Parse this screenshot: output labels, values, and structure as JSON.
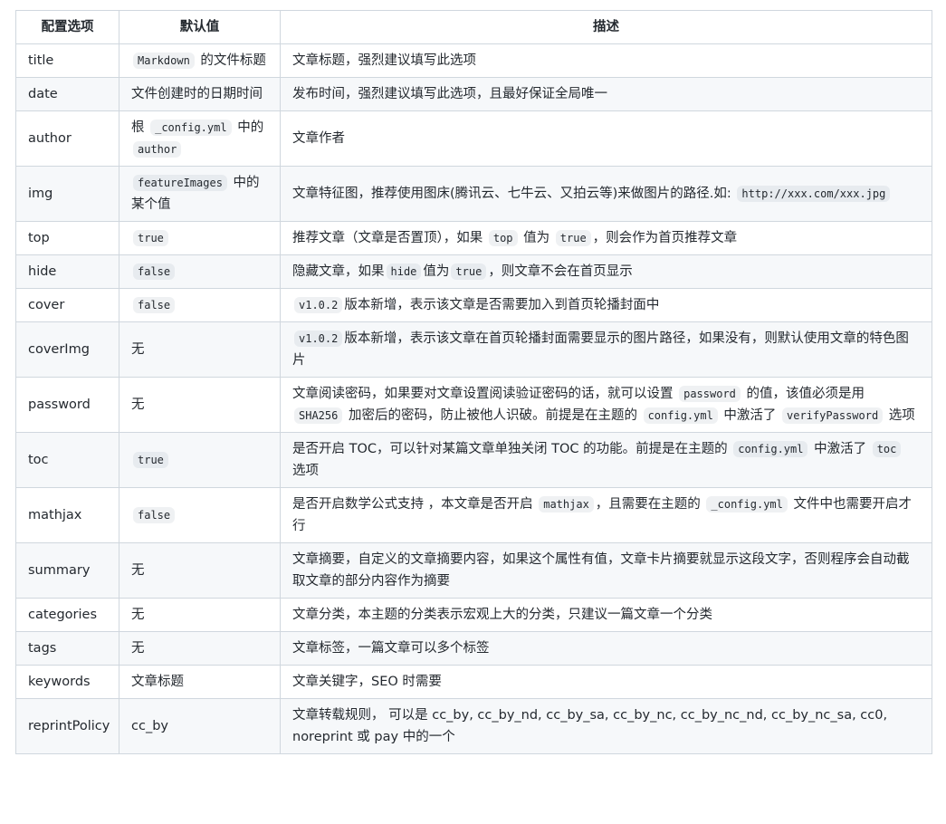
{
  "headers": [
    "配置选项",
    "默认值",
    "描述"
  ],
  "rows": [
    {
      "option": "title",
      "default": [
        {
          "code": "Markdown"
        },
        {
          "text": " 的文件标题"
        }
      ],
      "desc": [
        {
          "text": "文章标题，强烈建议填写此选项"
        }
      ]
    },
    {
      "option": "date",
      "default": [
        {
          "text": "文件创建时的日期时间"
        }
      ],
      "desc": [
        {
          "text": "发布时间，强烈建议填写此选项，且最好保证全局唯一"
        }
      ]
    },
    {
      "option": "author",
      "default": [
        {
          "text": "根 "
        },
        {
          "code": "_config.yml"
        },
        {
          "text": " 中的 "
        },
        {
          "code": "author"
        }
      ],
      "desc": [
        {
          "text": "文章作者"
        }
      ]
    },
    {
      "option": "img",
      "default": [
        {
          "code": "featureImages"
        },
        {
          "text": " 中的某个值"
        }
      ],
      "desc": [
        {
          "text": "文章特征图，推荐使用图床(腾讯云、七牛云、又拍云等)来做图片的路径.如: "
        },
        {
          "code": "http://xxx.com/xxx.jpg"
        }
      ]
    },
    {
      "option": "top",
      "default": [
        {
          "code": "true"
        }
      ],
      "desc": [
        {
          "text": "推荐文章（文章是否置顶），如果 "
        },
        {
          "code": "top"
        },
        {
          "text": " 值为 "
        },
        {
          "code": "true"
        },
        {
          "text": "，则会作为首页推荐文章"
        }
      ]
    },
    {
      "option": "hide",
      "default": [
        {
          "code": "false"
        }
      ],
      "desc": [
        {
          "text": "隐藏文章，如果"
        },
        {
          "code": "hide"
        },
        {
          "text": "值为"
        },
        {
          "code": "true"
        },
        {
          "text": "，则文章不会在首页显示"
        }
      ]
    },
    {
      "option": "cover",
      "default": [
        {
          "code": "false"
        }
      ],
      "desc": [
        {
          "code": "v1.0.2"
        },
        {
          "text": "版本新增，表示该文章是否需要加入到首页轮播封面中"
        }
      ]
    },
    {
      "option": "coverImg",
      "default": [
        {
          "text": "无"
        }
      ],
      "desc": [
        {
          "code": "v1.0.2"
        },
        {
          "text": "版本新增，表示该文章在首页轮播封面需要显示的图片路径，如果没有，则默认使用文章的特色图片"
        }
      ]
    },
    {
      "option": "password",
      "default": [
        {
          "text": "无"
        }
      ],
      "desc": [
        {
          "text": "文章阅读密码，如果要对文章设置阅读验证密码的话，就可以设置 "
        },
        {
          "code": "password"
        },
        {
          "text": " 的值，该值必须是用 "
        },
        {
          "code": "SHA256"
        },
        {
          "text": " 加密后的密码，防止被他人识破。前提是在主题的 "
        },
        {
          "code": "config.yml"
        },
        {
          "text": " 中激活了 "
        },
        {
          "code": "verifyPassword"
        },
        {
          "text": " 选项"
        }
      ]
    },
    {
      "option": "toc",
      "default": [
        {
          "code": "true"
        }
      ],
      "desc": [
        {
          "text": "是否开启 TOC，可以针对某篇文章单独关闭 TOC 的功能。前提是在主题的 "
        },
        {
          "code": "config.yml"
        },
        {
          "text": " 中激活了 "
        },
        {
          "code": "toc"
        },
        {
          "text": " 选项"
        }
      ]
    },
    {
      "option": "mathjax",
      "default": [
        {
          "code": "false"
        }
      ],
      "desc": [
        {
          "text": "是否开启数学公式支持 ，本文章是否开启 "
        },
        {
          "code": "mathjax"
        },
        {
          "text": "，且需要在主题的 "
        },
        {
          "code": "_config.yml"
        },
        {
          "text": " 文件中也需要开启才行"
        }
      ]
    },
    {
      "option": "summary",
      "default": [
        {
          "text": "无"
        }
      ],
      "desc": [
        {
          "text": "文章摘要，自定义的文章摘要内容，如果这个属性有值，文章卡片摘要就显示这段文字，否则程序会自动截取文章的部分内容作为摘要"
        }
      ]
    },
    {
      "option": "categories",
      "default": [
        {
          "text": "无"
        }
      ],
      "desc": [
        {
          "text": "文章分类，本主题的分类表示宏观上大的分类，只建议一篇文章一个分类"
        }
      ]
    },
    {
      "option": "tags",
      "default": [
        {
          "text": "无"
        }
      ],
      "desc": [
        {
          "text": "文章标签，一篇文章可以多个标签"
        }
      ]
    },
    {
      "option": "keywords",
      "default": [
        {
          "text": "文章标题"
        }
      ],
      "desc": [
        {
          "text": "文章关键字，SEO 时需要"
        }
      ]
    },
    {
      "option": "reprintPolicy",
      "default": [
        {
          "text": "cc_by"
        }
      ],
      "desc": [
        {
          "text": "文章转载规则， 可以是 cc_by, cc_by_nd, cc_by_sa, cc_by_nc, cc_by_nc_nd, cc_by_nc_sa, cc0, noreprint 或 pay 中的一个"
        }
      ]
    }
  ]
}
